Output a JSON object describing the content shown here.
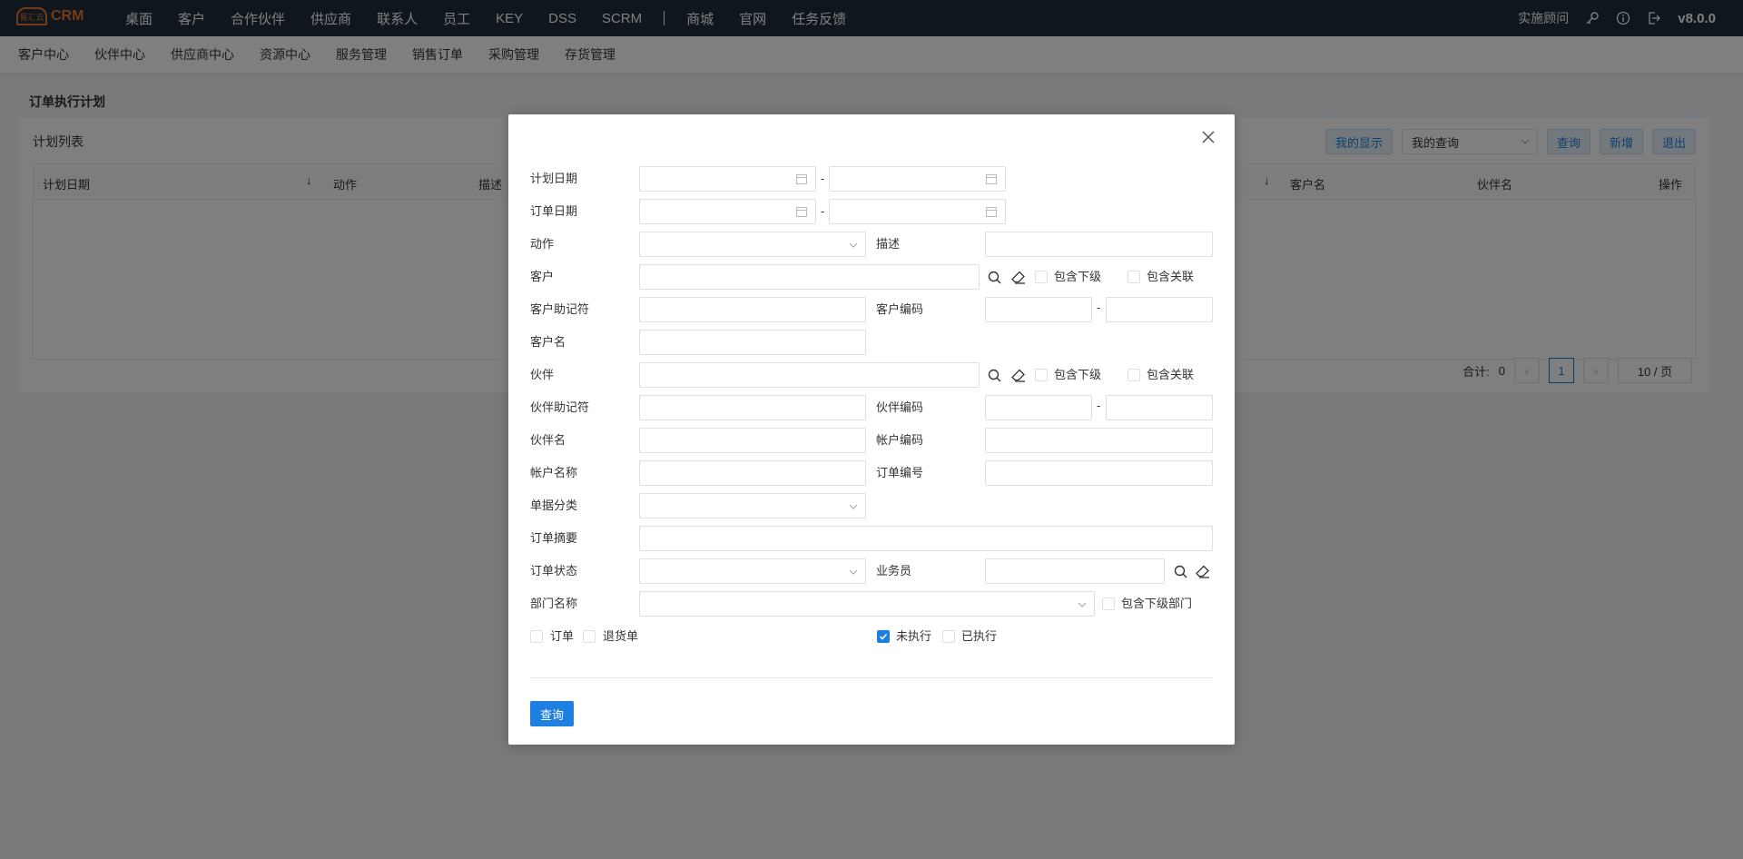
{
  "topbar": {
    "logo_small": "易汇云",
    "logo_text": "CRM",
    "nav": [
      "桌面",
      "客户",
      "合作伙伴",
      "供应商",
      "联系人",
      "员工",
      "KEY",
      "DSS",
      "SCRM",
      "商城",
      "官网",
      "任务反馈"
    ],
    "right_label": "实施顾问",
    "version": "v8.0.0"
  },
  "subbar": {
    "items": [
      "客户中心",
      "伙伴中心",
      "供应商中心",
      "资源中心",
      "服务管理",
      "销售订单",
      "采购管理",
      "存货管理"
    ]
  },
  "page": {
    "title": "订单执行计划",
    "list_title": "计划列表",
    "buttons": {
      "my_display": "我的显示",
      "my_query": "我的查询",
      "query": "查询",
      "add": "新增",
      "exit": "退出"
    },
    "columns": [
      "计划日期",
      "动作",
      "描述",
      "客户名",
      "伙伴名",
      "操作"
    ],
    "pager": {
      "total_label": "合计:",
      "total": "0",
      "current_page": "1",
      "page_size": "10 / 页"
    }
  },
  "modal": {
    "labels": {
      "plan_date": "计划日期",
      "order_date": "订单日期",
      "action": "动作",
      "desc": "描述",
      "customer": "客户",
      "include_sub": "包含下级",
      "include_rel": "包含关联",
      "customer_mnemonic": "客户助记符",
      "customer_code": "客户编码",
      "customer_name": "客户名",
      "partner": "伙伴",
      "partner_mnemonic": "伙伴助记符",
      "partner_code": "伙伴编码",
      "partner_name": "伙伴名",
      "account_code": "帐户编码",
      "account_name": "帐户名称",
      "order_no": "订单编号",
      "doc_category": "单据分类",
      "order_summary": "订单摘要",
      "order_status": "订单状态",
      "salesman": "业务员",
      "dept_name": "部门名称",
      "include_sub_dept": "包含下级部门",
      "order": "订单",
      "return_order": "退货单",
      "not_executed": "未执行",
      "executed": "已执行",
      "dash": "-"
    },
    "checks": {
      "not_executed": true,
      "executed": false,
      "order": false,
      "return_order": false
    },
    "query_button": "查询"
  }
}
